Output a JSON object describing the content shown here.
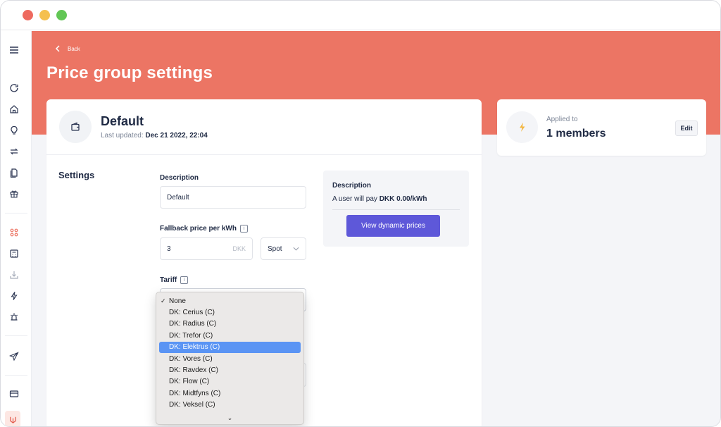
{
  "header": {
    "back_label": "Back",
    "page_title": "Price group settings"
  },
  "group": {
    "name": "Default",
    "updated_prefix": "Last updated:",
    "updated_value": "Dec 21 2022, 22:04"
  },
  "settings": {
    "heading": "Settings",
    "description_label": "Description",
    "description_value": "Default",
    "fallback_label": "Fallback price per kWh",
    "fallback_value": "3",
    "fallback_unit": "DKK",
    "price_type": "Spot",
    "tariff_label": "Tariff",
    "info_glyph": "i"
  },
  "description_panel": {
    "title": "Description",
    "text_prefix": "A user will pay",
    "text_value": "DKK 0.00/kWh",
    "button_label": "View dynamic prices"
  },
  "applied": {
    "label": "Applied to",
    "count": "1 members",
    "edit_label": "Edit"
  },
  "tariff_dropdown": {
    "options": [
      "None",
      "DK: Cerius (C)",
      "DK: Radius (C)",
      "DK: Trefor (C)",
      "DK: Elektrus (C)",
      "DK: Vores (C)",
      "DK: Ravdex (C)",
      "DK: Flow (C)",
      "DK: Midtfyns (C)",
      "DK: Veksel (C)"
    ],
    "checked_index": 0,
    "highlighted_index": 4,
    "more_glyph": "⌄"
  },
  "colors": {
    "brand": "#ec7564",
    "primary_button": "#5e58d9",
    "highlight": "#5a94f4",
    "bolt": "#f3b63f"
  },
  "sidebar_icons": [
    "menu-icon",
    "refresh-icon",
    "home-icon",
    "lightbulb-icon",
    "transfer-icon",
    "documents-icon",
    "gift-icon",
    "grid-icon",
    "calculator-icon",
    "download-icon",
    "bolt-icon",
    "alarm-icon",
    "send-icon",
    "card-icon",
    "logo-icon"
  ]
}
